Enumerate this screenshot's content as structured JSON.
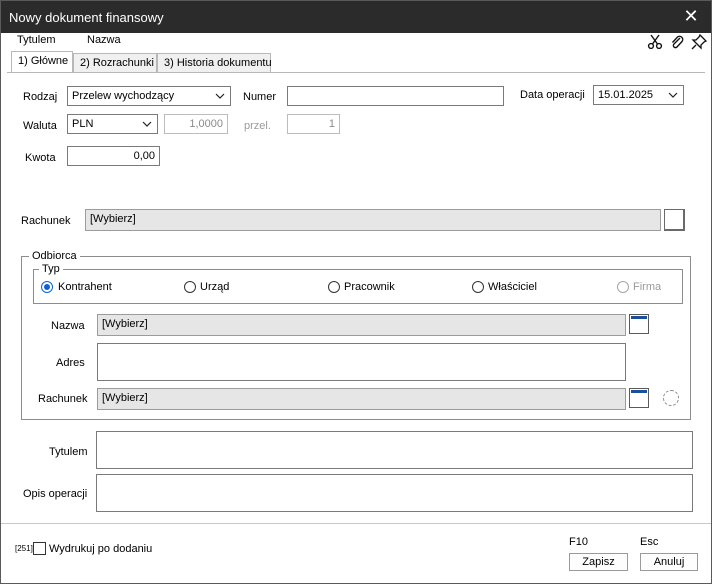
{
  "window": {
    "title": "Nowy dokument finansowy",
    "close_glyph": "✕"
  },
  "menu": {
    "items": [
      "Tytulem",
      "Nazwa"
    ]
  },
  "toolbar": {
    "icons": [
      "scissors-icon",
      "paperclip-icon",
      "pin-icon"
    ]
  },
  "tabs": [
    "1) Główne",
    "2) Rozrachunki",
    "3) Historia dokumentu"
  ],
  "form": {
    "rodzaj_label": "Rodzaj",
    "rodzaj_value": "Przelew wychodzący",
    "numer_label": "Numer",
    "numer_value": "",
    "data_operacji_label": "Data operacji",
    "data_operacji_value": "15.01.2025",
    "waluta_label": "Waluta",
    "waluta_value": "PLN",
    "kurs_value": "1,0000",
    "przel_label": "przel.",
    "przel_value": "1",
    "kwota_label": "Kwota",
    "kwota_value": "0,00",
    "rachunek_label": "Rachunek",
    "rachunek_value": "[Wybierz]"
  },
  "odbiorca": {
    "legend": "Odbiorca",
    "typ_legend": "Typ",
    "types": [
      {
        "label": "Kontrahent",
        "checked": true,
        "disabled": false
      },
      {
        "label": "Urząd",
        "checked": false,
        "disabled": false
      },
      {
        "label": "Pracownik",
        "checked": false,
        "disabled": false
      },
      {
        "label": "Właściciel",
        "checked": false,
        "disabled": false
      },
      {
        "label": "Firma",
        "checked": false,
        "disabled": true
      }
    ],
    "nazwa_label": "Nazwa",
    "nazwa_value": "[Wybierz]",
    "adres_label": "Adres",
    "adres_value": "",
    "rachunek_label": "Rachunek",
    "rachunek_value": "[Wybierz]"
  },
  "opis": {
    "tytulem_label": "Tytulem",
    "tytulem_value": "",
    "opis_label": "Opis operacji",
    "opis_value": ""
  },
  "footer": {
    "code": "[251]",
    "print_label": "Wydrukuj po dodaniu",
    "save_key": "F10",
    "save_label": "Zapisz",
    "cancel_key": "Esc",
    "cancel_label": "Anuluj"
  },
  "colors": {
    "titlebar": "#2b2b2b",
    "radio_accent": "#0a64d8",
    "field_gray": "#e6e6e6"
  }
}
